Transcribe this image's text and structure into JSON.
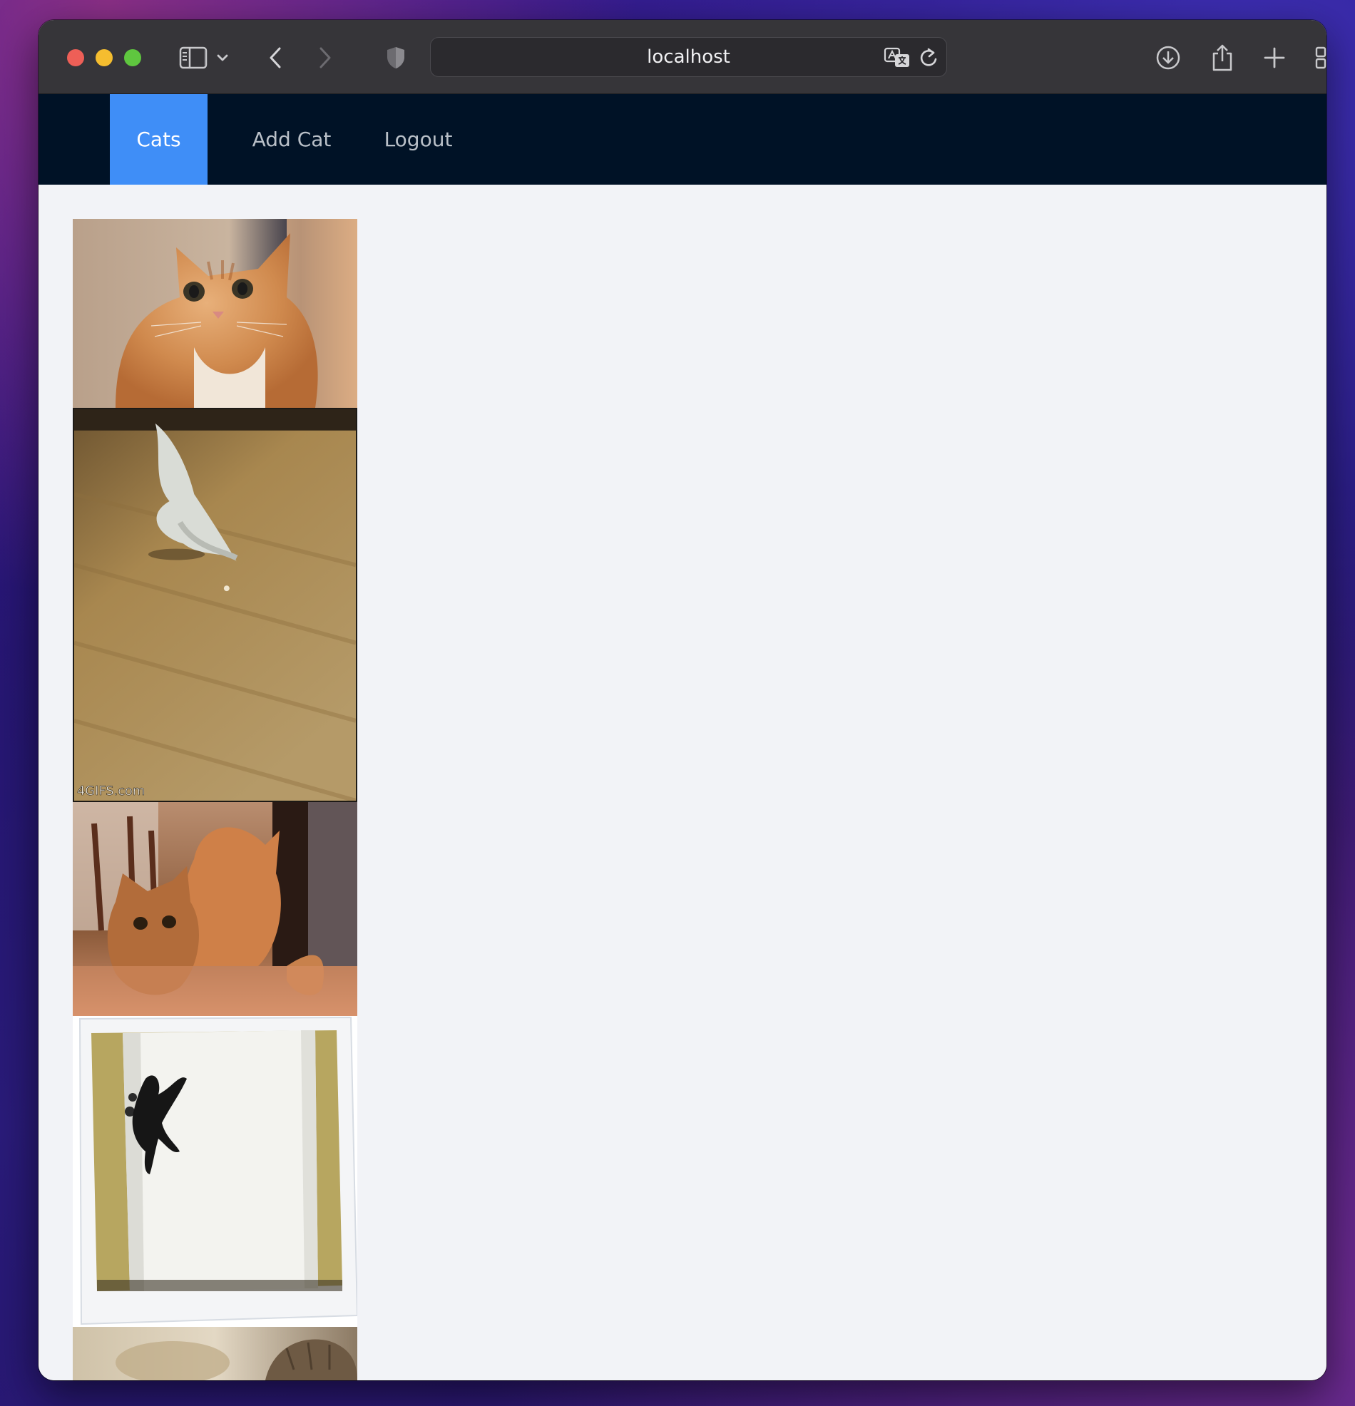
{
  "browser": {
    "url": "localhost",
    "icons": [
      "sidebar-icon",
      "chevron-down-icon",
      "back-icon",
      "forward-icon",
      "shield-icon",
      "translate-icon",
      "reload-icon",
      "download-icon",
      "share-icon",
      "new-tab-icon",
      "tab-overview-icon"
    ]
  },
  "nav": {
    "items": [
      {
        "label": "Cats",
        "active": true
      },
      {
        "label": "Add Cat",
        "active": false
      },
      {
        "label": "Logout",
        "active": false
      }
    ]
  },
  "gallery": {
    "images": [
      {
        "subject": "orange tabby cat looking at camera"
      },
      {
        "subject": "white cat sliding on wooden floor chasing laser",
        "watermark": "4GIFS.com"
      },
      {
        "subject": "orange cat hiding behind another cat"
      },
      {
        "subject": "black and white cat jumping on white door"
      },
      {
        "subject": "tabby cat (partially visible)"
      }
    ]
  },
  "colors": {
    "nav_background": "#001226",
    "nav_active": "#3f8ef7",
    "content_background": "#f2f3f7",
    "toolbar": "#363539"
  }
}
